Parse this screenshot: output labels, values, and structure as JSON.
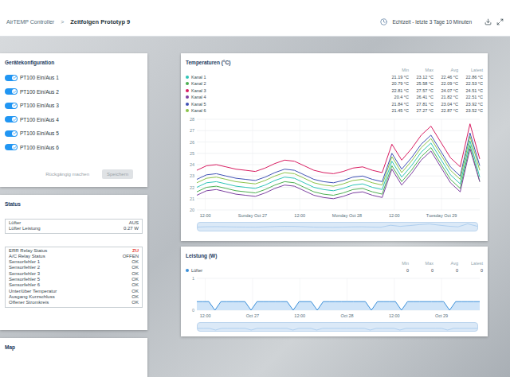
{
  "header": {
    "app": "AirTEMP Controller",
    "separator": ">",
    "page": "Zeitfolgen Prototyp 9",
    "range": "Echtzeit - letzte 3 Tage 10 Minuten"
  },
  "config": {
    "title": "Gerätekonfiguration",
    "toggles": [
      {
        "label": "PT100 Ein/Aus 1",
        "on": true
      },
      {
        "label": "PT100 Ein/Aus 2",
        "on": true
      },
      {
        "label": "PT100 Ein/Aus 3",
        "on": true
      },
      {
        "label": "PT100 Ein/Aus 4",
        "on": true
      },
      {
        "label": "PT100 Ein/Aus 5",
        "on": true
      },
      {
        "label": "PT100 Ein/Aus 6",
        "on": true
      }
    ],
    "buttons": [
      {
        "label": "Rückgängig machen",
        "kind": "text",
        "disabled": true
      },
      {
        "label": "Speichern",
        "kind": "filled",
        "disabled": true
      }
    ]
  },
  "status": {
    "title": "Status",
    "groups": [
      [
        {
          "label": "Lüfter",
          "value": "AUS",
          "alert": false
        },
        {
          "label": "Lüfter Leistung",
          "value": "0.27 W",
          "alert": false
        }
      ],
      [
        {
          "label": "ERR Relay Status",
          "value": "ZU",
          "alert": true
        },
        {
          "label": "A/C Relay Status",
          "value": "OFFEN",
          "alert": false
        },
        {
          "label": "Sensorfehler 1",
          "value": "OK",
          "alert": false
        },
        {
          "label": "Sensorfehler 2",
          "value": "OK",
          "alert": false
        },
        {
          "label": "Sensorfehler 3",
          "value": "OK",
          "alert": false
        },
        {
          "label": "Sensorfehler 5",
          "value": "OK",
          "alert": false
        },
        {
          "label": "Sensorfehler 6",
          "value": "OK",
          "alert": false
        },
        {
          "label": "Unter/über Temperatur",
          "value": "OK",
          "alert": false
        },
        {
          "label": "Ausgang Kurzschluss",
          "value": "OK",
          "alert": false
        },
        {
          "label": "Offener Stromkreis",
          "value": "OK",
          "alert": false
        }
      ]
    ]
  },
  "map": {
    "title": "Map"
  },
  "temperature": {
    "title": "Temperaturen (°C)",
    "columns": [
      "Min",
      "Max",
      "Avg",
      "Latest"
    ],
    "y_ticks": [
      "28",
      "27",
      "26",
      "25",
      "24",
      "23",
      "22",
      "21",
      "20"
    ],
    "x_labels": [
      "12:00",
      "Sunday Oct 27",
      "12:00",
      "Monday Oct 28",
      "12:00",
      "Tuesday Oct 29"
    ],
    "series": [
      {
        "name": "Kanal 1",
        "color": "#2ec4b6",
        "stats": [
          "21.19 °C",
          "23.12 °C",
          "22.46 °C",
          "22.86 °C"
        ],
        "values": [
          22.0,
          22.4,
          22.5,
          22.3,
          22.1,
          22.0,
          21.9,
          22.2,
          22.6,
          22.9,
          22.8,
          22.4,
          22.0,
          21.8,
          21.7,
          21.9,
          22.2,
          22.3,
          22.0,
          21.8,
          24.3,
          22.9,
          23.9,
          25.1,
          25.9,
          24.5,
          23.1,
          22.3,
          26.1,
          22.9
        ]
      },
      {
        "name": "Kanal 2",
        "color": "#4caf50",
        "stats": [
          "20.79 °C",
          "25.58 °C",
          "22.09 °C",
          "22.53 °C"
        ],
        "values": [
          21.6,
          22.0,
          22.1,
          21.9,
          21.7,
          21.6,
          21.5,
          21.8,
          22.2,
          22.5,
          22.4,
          22.0,
          21.6,
          21.4,
          21.3,
          21.5,
          21.8,
          21.9,
          21.6,
          21.4,
          23.9,
          22.5,
          23.5,
          24.7,
          25.5,
          24.1,
          22.7,
          21.9,
          25.7,
          22.5
        ]
      },
      {
        "name": "Kanal 3",
        "color": "#d81b60",
        "stats": [
          "22.81 °C",
          "27.57 °C",
          "24.07 °C",
          "24.51 °C"
        ],
        "values": [
          23.5,
          23.9,
          24.0,
          23.8,
          23.6,
          23.5,
          23.4,
          23.7,
          24.1,
          24.4,
          24.3,
          23.9,
          23.5,
          23.3,
          23.2,
          23.4,
          23.7,
          23.8,
          23.5,
          23.3,
          25.8,
          24.4,
          25.4,
          26.6,
          27.4,
          26.0,
          24.6,
          23.8,
          27.6,
          24.5
        ]
      },
      {
        "name": "Kanal 4",
        "color": "#7b3fa0",
        "stats": [
          "20.4 °C",
          "26.41 °C",
          "21.82 °C",
          "22.51 °C"
        ],
        "values": [
          21.3,
          21.7,
          21.8,
          21.6,
          21.4,
          21.3,
          21.2,
          21.5,
          21.9,
          22.2,
          22.1,
          21.7,
          21.3,
          21.1,
          21.0,
          21.2,
          21.5,
          21.6,
          21.3,
          21.1,
          23.6,
          22.2,
          23.2,
          24.4,
          25.2,
          23.8,
          22.4,
          21.6,
          25.4,
          22.5
        ]
      },
      {
        "name": "Kanal 5",
        "color": "#3f51b5",
        "stats": [
          "21.84 °C",
          "27.81 °C",
          "23.04 °C",
          "23.92 °C"
        ],
        "values": [
          22.7,
          23.1,
          23.2,
          23.0,
          22.8,
          22.7,
          22.6,
          22.9,
          23.3,
          23.6,
          23.5,
          23.1,
          22.7,
          22.5,
          22.4,
          22.6,
          22.9,
          23.0,
          22.7,
          22.5,
          25.0,
          23.6,
          24.6,
          25.8,
          26.6,
          25.2,
          23.8,
          23.0,
          26.8,
          23.9
        ]
      },
      {
        "name": "Kanal 6",
        "color": "#8bc34a",
        "stats": [
          "21.45 °C",
          "27.27 °C",
          "22.87 °C",
          "23.52 °C"
        ],
        "values": [
          22.4,
          22.8,
          22.9,
          22.7,
          22.5,
          22.4,
          22.3,
          22.6,
          23.0,
          23.3,
          23.2,
          22.8,
          22.4,
          22.2,
          22.1,
          22.3,
          22.6,
          22.7,
          22.4,
          22.2,
          24.7,
          23.3,
          24.3,
          25.5,
          26.3,
          24.9,
          23.5,
          22.7,
          26.5,
          23.5
        ]
      }
    ]
  },
  "power": {
    "title": "Leistung (W)",
    "columns": [
      "Min",
      "Max",
      "Avg",
      "Latest"
    ],
    "y_ticks": [
      "1",
      "0"
    ],
    "x_labels": [
      "12:00",
      "Oct 27",
      "12:00",
      "Oct 28",
      "12:00",
      "Oct 29"
    ],
    "series": [
      {
        "name": "Lüfter",
        "color": "#3b8fd9",
        "stats": [
          "0",
          "0",
          "0",
          "0"
        ],
        "values": [
          0.27,
          0.27,
          0.27,
          0,
          0.27,
          0.27,
          0.27,
          0.27,
          0.27,
          0,
          0.27,
          0.27,
          0.27,
          0.27,
          0.27,
          0.27,
          0,
          0.27,
          0.27,
          0.27,
          0,
          0.27,
          0.27,
          0.27,
          0.27,
          0.27,
          0.27,
          0.27,
          0.27,
          0,
          0.27,
          0.27,
          0.27,
          0.27,
          0,
          0.27,
          0.27,
          0.27,
          0.27,
          0.27,
          0.27,
          0.27,
          0,
          0.27,
          0.27,
          0.27,
          0.27,
          0.27
        ]
      }
    ]
  }
}
